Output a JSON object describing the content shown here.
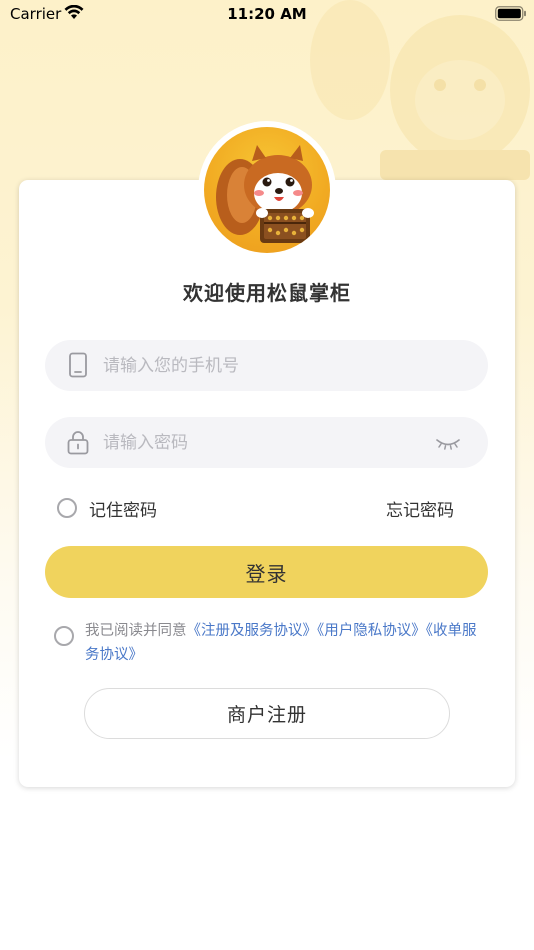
{
  "status_bar": {
    "carrier": "Carrier",
    "time": "11:20 AM"
  },
  "login": {
    "welcome_title": "欢迎使用松鼠掌柜",
    "phone_placeholder": "请输入您的手机号",
    "password_placeholder": "请输入密码",
    "remember_label": "记住密码",
    "forgot_label": "忘记密码",
    "login_button": "登录",
    "agreement_prefix": "我已阅读并同意",
    "agreement_link_1": "《注册及服务协议》",
    "agreement_link_2": "《用户隐私协议》",
    "agreement_link_3": "《收单服务协议》",
    "register_button": "商户注册"
  },
  "icons": {
    "avatar": "squirrel-mascot-icon",
    "phone": "phone-icon",
    "lock": "lock-icon",
    "password_toggle": "eye-closed-icon",
    "wifi": "wifi-icon",
    "battery": "battery-icon"
  },
  "colors": {
    "accent": "#f0d35d",
    "link": "#4a78c8",
    "header_background": "#fdf1c9"
  }
}
